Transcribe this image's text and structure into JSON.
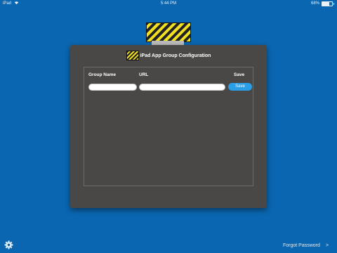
{
  "status_bar": {
    "device": "iPad",
    "wifi_icon": "wifi-icon",
    "time": "5:44 PM",
    "battery_text": "68%",
    "battery_level": 0.68
  },
  "logo": {
    "icon": "hazard-stripe-logo",
    "colors": [
      "#f0e020",
      "#222222"
    ]
  },
  "dialog": {
    "title": "iPad App Group Configuration",
    "title_icon": "hazard-stripe-icon",
    "columns": {
      "group_name": "Group Name",
      "url": "URL",
      "save": "Save"
    },
    "row": {
      "group_name_value": "",
      "url_value": "",
      "save_label": "Save"
    }
  },
  "footer": {
    "settings_icon": "gear-icon",
    "forgot_password": "Forgot Password",
    "chevron": ">"
  },
  "colors": {
    "background": "#0a66b0",
    "dialog": "#4a4847",
    "accent": "#2a9ee6"
  }
}
